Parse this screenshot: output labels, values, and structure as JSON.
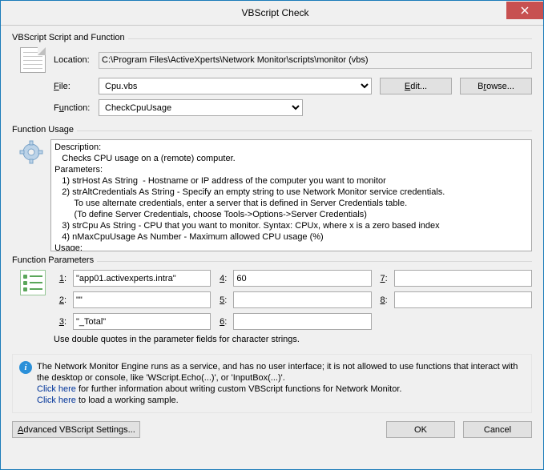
{
  "title": "VBScript Check",
  "group_script": {
    "label": "VBScript Script and Function",
    "location_label": "Location:",
    "location_value": "C:\\Program Files\\ActiveXperts\\Network Monitor\\scripts\\monitor (vbs)",
    "file_label": "File:",
    "file_value": "Cpu.vbs",
    "edit_btn": "Edit...",
    "browse_btn": "Browse...",
    "function_label": "Function:",
    "function_value": "CheckCpuUsage"
  },
  "group_usage": {
    "label": "Function Usage",
    "text": "Description:\n   Checks CPU usage on a (remote) computer.\nParameters:\n   1) strHost As String  - Hostname or IP address of the computer you want to monitor\n   2) strAltCredentials As String - Specify an empty string to use Network Monitor service credentials.\n        To use alternate credentials, enter a server that is defined in Server Credentials table.\n        (To define Server Credentials, choose Tools->Options->Server Credentials)\n   3) strCpu As String - CPU that you want to monitor. Syntax: CPUx, where x is a zero based index\n   4) nMaxCpuUsage As Number - Maximum allowed CPU usage (%)\nUsage:\n   CheckCpuUsage( \"<Hostname | IP>\", \"<Empty String | Server>\", \"<_Total|0|1|...>\", <Max_Cpu_Percent> )"
  },
  "group_params": {
    "label": "Function Parameters",
    "p1_label": "1:",
    "p2_label": "2:",
    "p3_label": "3:",
    "p4_label": "4:",
    "p5_label": "5:",
    "p6_label": "6:",
    "p7_label": "7:",
    "p8_label": "8:",
    "p1": "\"app01.activexperts.intra\"",
    "p2": "\"\"",
    "p3": "\"_Total\"",
    "p4": "60",
    "p5": "",
    "p6": "",
    "p7": "",
    "p8": "",
    "hint": "Use double quotes in the parameter fields for character strings."
  },
  "note": {
    "text": "The Network Monitor Engine runs as a service, and has no user interface; it is not allowed to use functions that interact with the desktop or console, like 'WScript.Echo(...)', or 'InputBox(...)'.",
    "link1_pre": "Click here",
    "link1_post": " for further information about writing custom VBScript functions for Network Monitor.",
    "link2_pre": "Click here",
    "link2_post": " to load a working sample."
  },
  "buttons": {
    "advanced": "Advanced VBScript Settings...",
    "ok": "OK",
    "cancel": "Cancel"
  }
}
